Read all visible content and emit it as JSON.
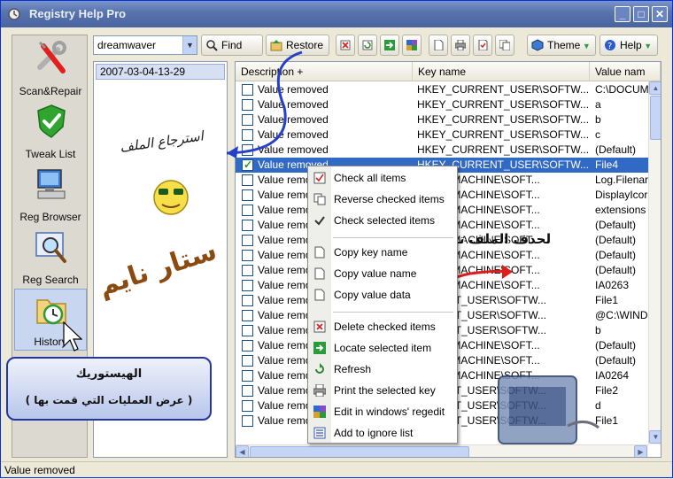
{
  "window": {
    "title": "Registry Help Pro",
    "controls": {
      "minimize": "_",
      "maximize": "□",
      "close": "✕"
    }
  },
  "sidebar": {
    "items": [
      {
        "label": "Scan&Repair",
        "icon": "wrench-screwdriver-icon"
      },
      {
        "label": "Tweak List",
        "icon": "shield-check-icon"
      },
      {
        "label": "Reg Browser",
        "icon": "computer-icon"
      },
      {
        "label": "Reg Search",
        "icon": "magnifier-icon"
      },
      {
        "label": "History",
        "icon": "clock-folder-icon",
        "active": true
      }
    ]
  },
  "toolbar": {
    "combo_value": "dreamwaver",
    "find_label": "Find",
    "restore_label": "Restore",
    "theme_label": "Theme",
    "help_label": "Help"
  },
  "history": {
    "entries": [
      "2007-03-04-13-29"
    ]
  },
  "grid": {
    "columns": [
      "Description  +",
      "Key name",
      "Value nam"
    ],
    "rows": [
      {
        "checked": false,
        "desc": "Value removed",
        "key": "HKEY_CURRENT_USER\\SOFTW...",
        "value": "C:\\DOCUM"
      },
      {
        "checked": false,
        "desc": "Value removed",
        "key": "HKEY_CURRENT_USER\\SOFTW...",
        "value": "a"
      },
      {
        "checked": false,
        "desc": "Value removed",
        "key": "HKEY_CURRENT_USER\\SOFTW...",
        "value": "b"
      },
      {
        "checked": false,
        "desc": "Value removed",
        "key": "HKEY_CURRENT_USER\\SOFTW...",
        "value": "c"
      },
      {
        "checked": false,
        "desc": "Value removed",
        "key": "HKEY_CURRENT_USER\\SOFTW...",
        "value": "(Default)"
      },
      {
        "checked": true,
        "selected": true,
        "desc": "Value removed",
        "key": "HKEY_CURRENT_USER\\SOFTW...",
        "value": "File4"
      },
      {
        "checked": false,
        "desc": "Value remo",
        "key": "OCAL_MACHINE\\SOFT...",
        "value": "Log.Filenar"
      },
      {
        "checked": false,
        "desc": "Value remo",
        "key": "OCAL_MACHINE\\SOFT...",
        "value": "DisplayIcor"
      },
      {
        "checked": false,
        "desc": "Value remo",
        "key": "OCAL_MACHINE\\SOFT...",
        "value": "extensions"
      },
      {
        "checked": false,
        "desc": "Value remo",
        "key": "OCAL_MACHINE\\SOFT...",
        "value": "(Default)"
      },
      {
        "checked": false,
        "desc": "Value remo",
        "key": "OCAL_MACHINE\\SOFT...",
        "value": "(Default)"
      },
      {
        "checked": false,
        "desc": "Value remo",
        "key": "OCAL_MACHINE\\SOFT...",
        "value": "(Default)"
      },
      {
        "checked": false,
        "desc": "Value remo",
        "key": "OCAL_MACHINE\\SOFT...",
        "value": "(Default)"
      },
      {
        "checked": false,
        "desc": "Value remo",
        "key": "OCAL_MACHINE\\SOFT...",
        "value": "IA0263"
      },
      {
        "checked": false,
        "desc": "Value remo",
        "key": "URRENT_USER\\SOFTW...",
        "value": "File1"
      },
      {
        "checked": false,
        "desc": "Value remo",
        "key": "URRENT_USER\\SOFTW...",
        "value": "@C:\\WIND"
      },
      {
        "checked": false,
        "desc": "Value remo",
        "key": "URRENT_USER\\SOFTW...",
        "value": "b"
      },
      {
        "checked": false,
        "desc": "Value remo",
        "key": "OCAL_MACHINE\\SOFT...",
        "value": "(Default)"
      },
      {
        "checked": false,
        "desc": "Value remo",
        "key": "OCAL_MACHINE\\SOFT...",
        "value": "(Default)"
      },
      {
        "checked": false,
        "desc": "Value remo",
        "key": "OCAL_MACHINE\\SOFT...",
        "value": "IA0264"
      },
      {
        "checked": false,
        "desc": "Value remo",
        "key": "URRENT_USER\\SOFTW...",
        "value": "File2"
      },
      {
        "checked": false,
        "desc": "Value remo",
        "key": "URRENT_USER\\SOFTW...",
        "value": "d"
      },
      {
        "checked": false,
        "desc": "Value remo",
        "key": "URRENT_USER\\SOFTW...",
        "value": "File1"
      }
    ]
  },
  "context_menu": {
    "items": [
      {
        "label": "Check all items",
        "icon": "check-all-icon"
      },
      {
        "label": "Reverse checked items",
        "icon": "reverse-icon"
      },
      {
        "label": "Check selected items",
        "icon": "checkbox-icon"
      },
      {
        "separator": true
      },
      {
        "label": "Copy key name",
        "icon": "copy-icon"
      },
      {
        "label": "Copy value name",
        "icon": "copy-icon"
      },
      {
        "label": "Copy value data",
        "icon": "copy-icon"
      },
      {
        "separator": true
      },
      {
        "label": "Delete checked items",
        "icon": "delete-icon"
      },
      {
        "label": "Locate selected item",
        "icon": "locate-icon"
      },
      {
        "label": "Refresh",
        "icon": "refresh-icon"
      },
      {
        "label": "Print the selected key",
        "icon": "printer-icon"
      },
      {
        "label": "Edit in windows' regedit",
        "icon": "regedit-icon"
      },
      {
        "label": "Add to ignore list",
        "icon": "list-icon"
      }
    ]
  },
  "status": {
    "text": "Value removed"
  },
  "annotations": {
    "restore_hint": "استرجاع الملف",
    "delete_hint": "لحذف الملف نهائيا اضغط هنا",
    "signature": "ستار نايم",
    "callout_title": "الهيستوريك",
    "callout_body": "( عرض العمليات التي قمت بها )"
  },
  "colors": {
    "title_bar": "#5a74b0",
    "selection": "#316ac5",
    "arrow_blue": "#2540c8",
    "arrow_red": "#e01b1b"
  }
}
